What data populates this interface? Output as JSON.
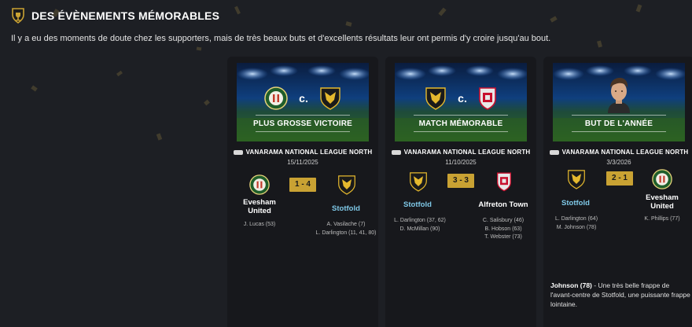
{
  "header": {
    "icon": "trophy-crest-icon",
    "title": "DES ÉVÈNEMENTS MÉMORABLES",
    "subtitle": "Il y a eu des moments de doute chez les supporters, mais de très beaux buts et d'excellents résultats leur ont permis d'y croire jusqu'au bout."
  },
  "colors": {
    "accent_gold": "#c9a233",
    "team_highlight": "#7fc9e8",
    "card_bg": "#17181c",
    "page_bg": "#1d1f24"
  },
  "cards": [
    {
      "banner_label": "PLUS GROSSE VICTOIRE",
      "vs_text": "c.",
      "league": "VANARAMA NATIONAL LEAGUE NORTH",
      "date": "15/11/2025",
      "score": "1 - 4",
      "home": {
        "name": "Evesham United",
        "crest": "evesham-crest-icon",
        "scorers": [
          "J. Lucas (53)"
        ]
      },
      "away": {
        "name": "Stotfold",
        "crest": "stotfold-crest-icon",
        "scorers": [
          "A. Vasilache (7)",
          "L. Darlington (11, 41, 80)"
        ]
      }
    },
    {
      "banner_label": "MATCH MÉMORABLE",
      "vs_text": "c.",
      "league": "VANARAMA NATIONAL LEAGUE NORTH",
      "date": "11/10/2025",
      "score": "3 - 3",
      "home": {
        "name": "Stotfold",
        "crest": "stotfold-crest-icon",
        "scorers": [
          "L. Darlington (37, 62)",
          "D. McMillan (90)"
        ]
      },
      "away": {
        "name": "Alfreton Town",
        "crest": "alfreton-crest-icon",
        "scorers": [
          "C. Salisbury (46)",
          "B. Hobson (63)",
          "T. Webster (73)"
        ]
      }
    },
    {
      "banner_label": "BUT DE L'ANNÉE",
      "league": "VANARAMA NATIONAL LEAGUE NORTH",
      "date": "3/3/2026",
      "score": "2 - 1",
      "home": {
        "name": "Stotfold",
        "crest": "stotfold-crest-icon",
        "scorers": [
          "L. Darlington (64)",
          "M. Johnson (78)"
        ]
      },
      "away": {
        "name": "Evesham United",
        "crest": "evesham-crest-icon",
        "scorers": [
          "K. Phillips (77)"
        ]
      },
      "description_author": "Johnson (78)",
      "description_text": " - Une très belle frappe de l'avant-centre de Stotfold, une puissante frappe lointaine."
    }
  ]
}
